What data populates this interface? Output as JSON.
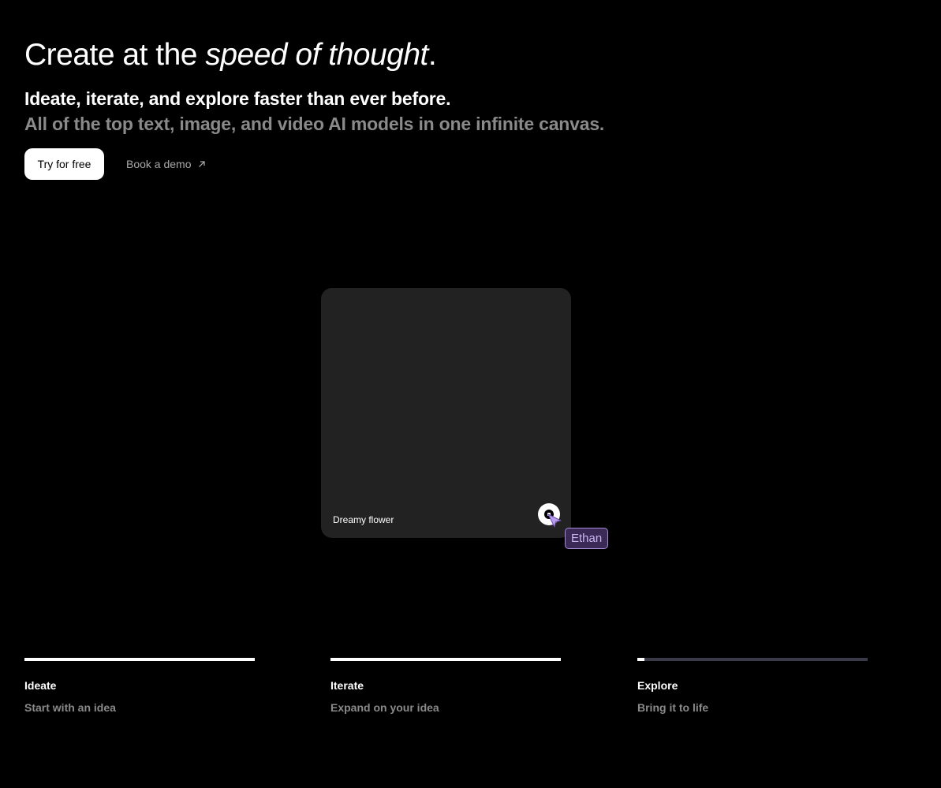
{
  "hero": {
    "headline_plain": "Create at the ",
    "headline_italic": "speed of thought",
    "headline_end": ".",
    "subtitle": "Ideate, iterate, and explore faster than ever before.",
    "tagline": "All of the top text, image, and video AI models in one infinite canvas."
  },
  "actions": {
    "try_label": "Try for free",
    "demo_label": "Book a demo",
    "demo_icon": "arrow-up-right-icon"
  },
  "canvas": {
    "card_label": "Dreamy flower",
    "logo_icon": "brand-logo-icon",
    "cursor_icon": "cursor-icon",
    "collaborator_name": "Ethan",
    "collaborator_color": "#c9b4f2"
  },
  "features": [
    {
      "title": "Ideate",
      "description": "Start with an idea",
      "progress": 1.0
    },
    {
      "title": "Iterate",
      "description": "Expand on your idea",
      "progress": 1.0
    },
    {
      "title": "Explore",
      "description": "Bring it to life",
      "progress": 0.03
    }
  ],
  "colors": {
    "background": "#000000",
    "card": "#222222",
    "muted_text": "#8a8a8a",
    "progress_track": "#3a3a48",
    "accent": "#a58bd9"
  }
}
